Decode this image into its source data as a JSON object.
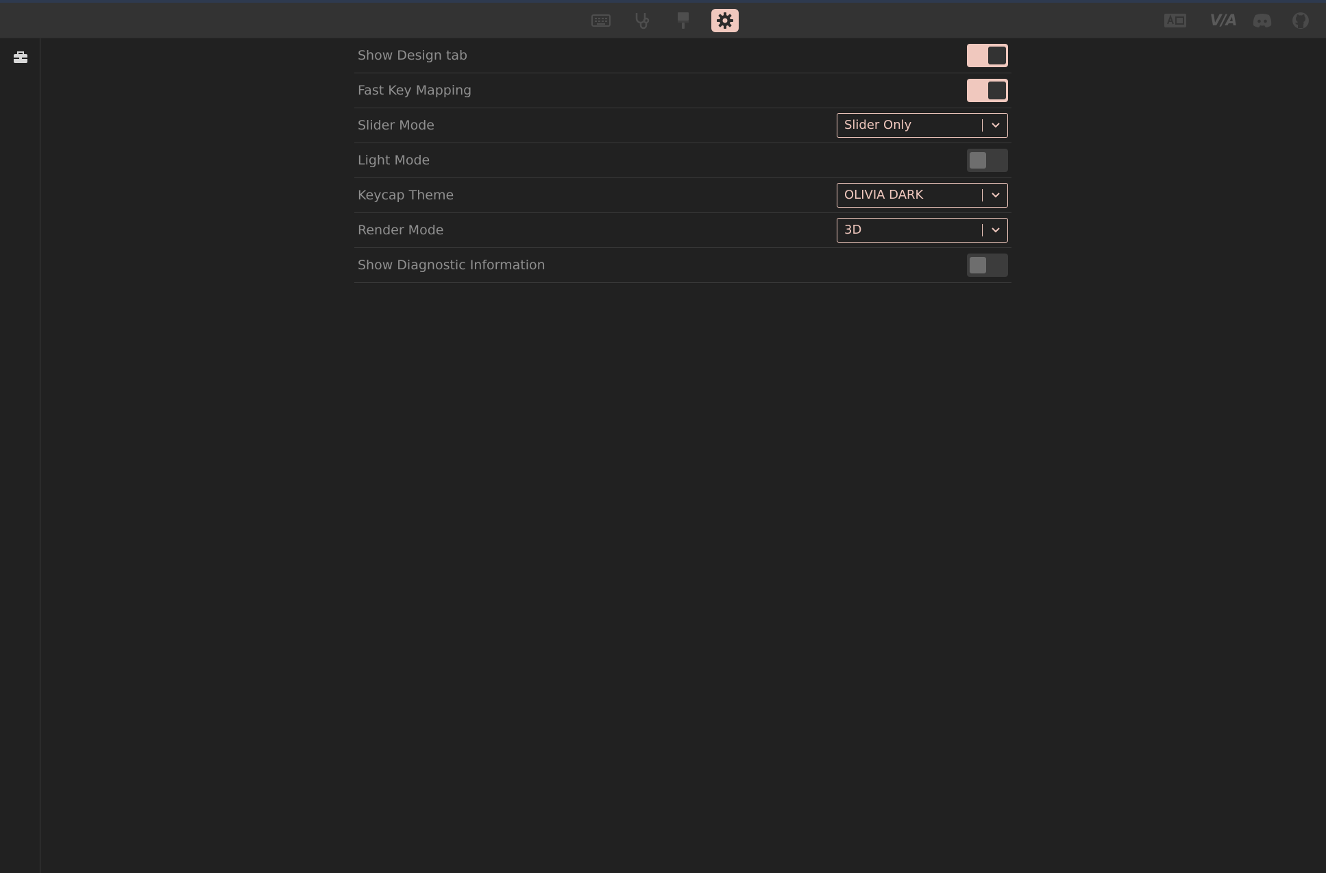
{
  "topbar": {
    "nav": [
      {
        "name": "keyboard-icon",
        "active": false
      },
      {
        "name": "stethoscope-icon",
        "active": false
      },
      {
        "name": "paintbrush-icon",
        "active": false
      },
      {
        "name": "gear-icon",
        "active": true
      }
    ],
    "right": {
      "via_logo": "V/A"
    }
  },
  "sidebar": {
    "icon": "toolbox-icon"
  },
  "settings": [
    {
      "label": "Show Design tab",
      "control": "toggle",
      "state": "on"
    },
    {
      "label": "Fast Key Mapping",
      "control": "toggle",
      "state": "on"
    },
    {
      "label": "Slider Mode",
      "control": "select",
      "value": "Slider Only"
    },
    {
      "label": "Light Mode",
      "control": "toggle",
      "state": "off"
    },
    {
      "label": "Keycap Theme",
      "control": "select",
      "value": "OLIVIA DARK"
    },
    {
      "label": "Render Mode",
      "control": "select",
      "value": "3D"
    },
    {
      "label": "Show Diagnostic Information",
      "control": "toggle",
      "state": "off"
    }
  ],
  "colors": {
    "accent": "#f0c8be",
    "background": "#212121",
    "topbar": "#333333",
    "label_text": "#8f8f8f"
  }
}
